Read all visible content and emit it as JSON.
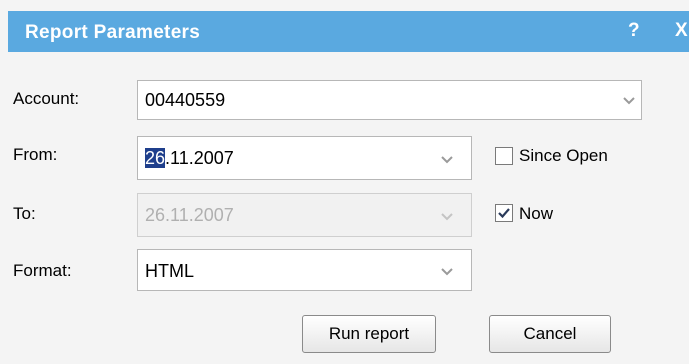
{
  "title": "Report Parameters",
  "titlebar": {
    "help": "?",
    "close": "X"
  },
  "account": {
    "label": "Account:",
    "value": "00440559"
  },
  "from": {
    "label": "From:",
    "value_selected": "26",
    "value_rest": ".11.2007"
  },
  "to": {
    "label": "To:",
    "value": "26.11.2007",
    "disabled": true
  },
  "format": {
    "label": "Format:",
    "value": "HTML"
  },
  "since_open": {
    "label": "Since Open",
    "checked": false
  },
  "now": {
    "label": "Now",
    "checked": true
  },
  "buttons": {
    "run": "Run report",
    "cancel": "Cancel"
  },
  "colors": {
    "titlebar": "#5aa9e0",
    "selection": "#1f3f8c"
  }
}
